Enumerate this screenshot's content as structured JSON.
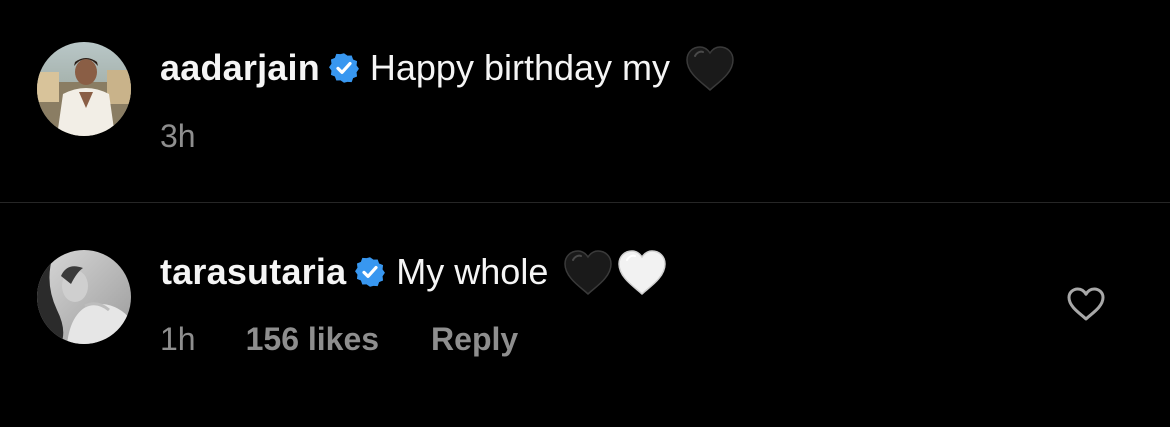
{
  "comments": [
    {
      "username": "aadarjain",
      "verified": true,
      "text": "Happy birthday my",
      "emojis": [
        "black-heart"
      ],
      "time": "3h"
    },
    {
      "username": "tarasutaria",
      "verified": true,
      "text": "My whole",
      "emojis": [
        "black-heart",
        "white-heart"
      ],
      "time": "1h",
      "likes": "156 likes",
      "reply": "Reply"
    }
  ],
  "colors": {
    "background": "#000000",
    "primary_text": "#f5f5f5",
    "secondary_text": "#8e8e8e",
    "verified_badge": "#3897f0",
    "divider": "#262626"
  }
}
